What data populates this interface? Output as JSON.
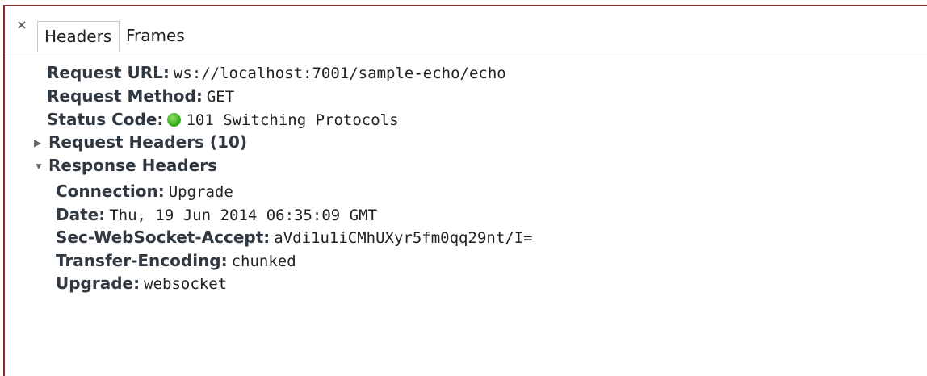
{
  "tabs": {
    "headers": "Headers",
    "frames": "Frames"
  },
  "general": {
    "request_url_label": "Request URL:",
    "request_url_value": "ws://localhost:7001/sample-echo/echo",
    "request_method_label": "Request Method:",
    "request_method_value": "GET",
    "status_code_label": "Status Code:",
    "status_code_value": "101 Switching Protocols",
    "status_color": "#3cb31e"
  },
  "request_headers": {
    "title": "Request Headers (10)",
    "expanded": false
  },
  "response_headers": {
    "title": "Response Headers",
    "expanded": true,
    "items": [
      {
        "key": "Connection:",
        "value": "Upgrade"
      },
      {
        "key": "Date:",
        "value": "Thu, 19 Jun 2014 06:35:09 GMT"
      },
      {
        "key": "Sec-WebSocket-Accept:",
        "value": "aVdi1u1iCMhUXyr5fm0qq29nt/I="
      },
      {
        "key": "Transfer-Encoding:",
        "value": "chunked"
      },
      {
        "key": "Upgrade:",
        "value": "websocket"
      }
    ]
  },
  "icons": {
    "close": "close-icon",
    "collapsed": "triangle-right-icon",
    "expanded": "triangle-down-icon"
  },
  "colors": {
    "frame_border": "#8a2b2b",
    "key_text": "#303942"
  }
}
